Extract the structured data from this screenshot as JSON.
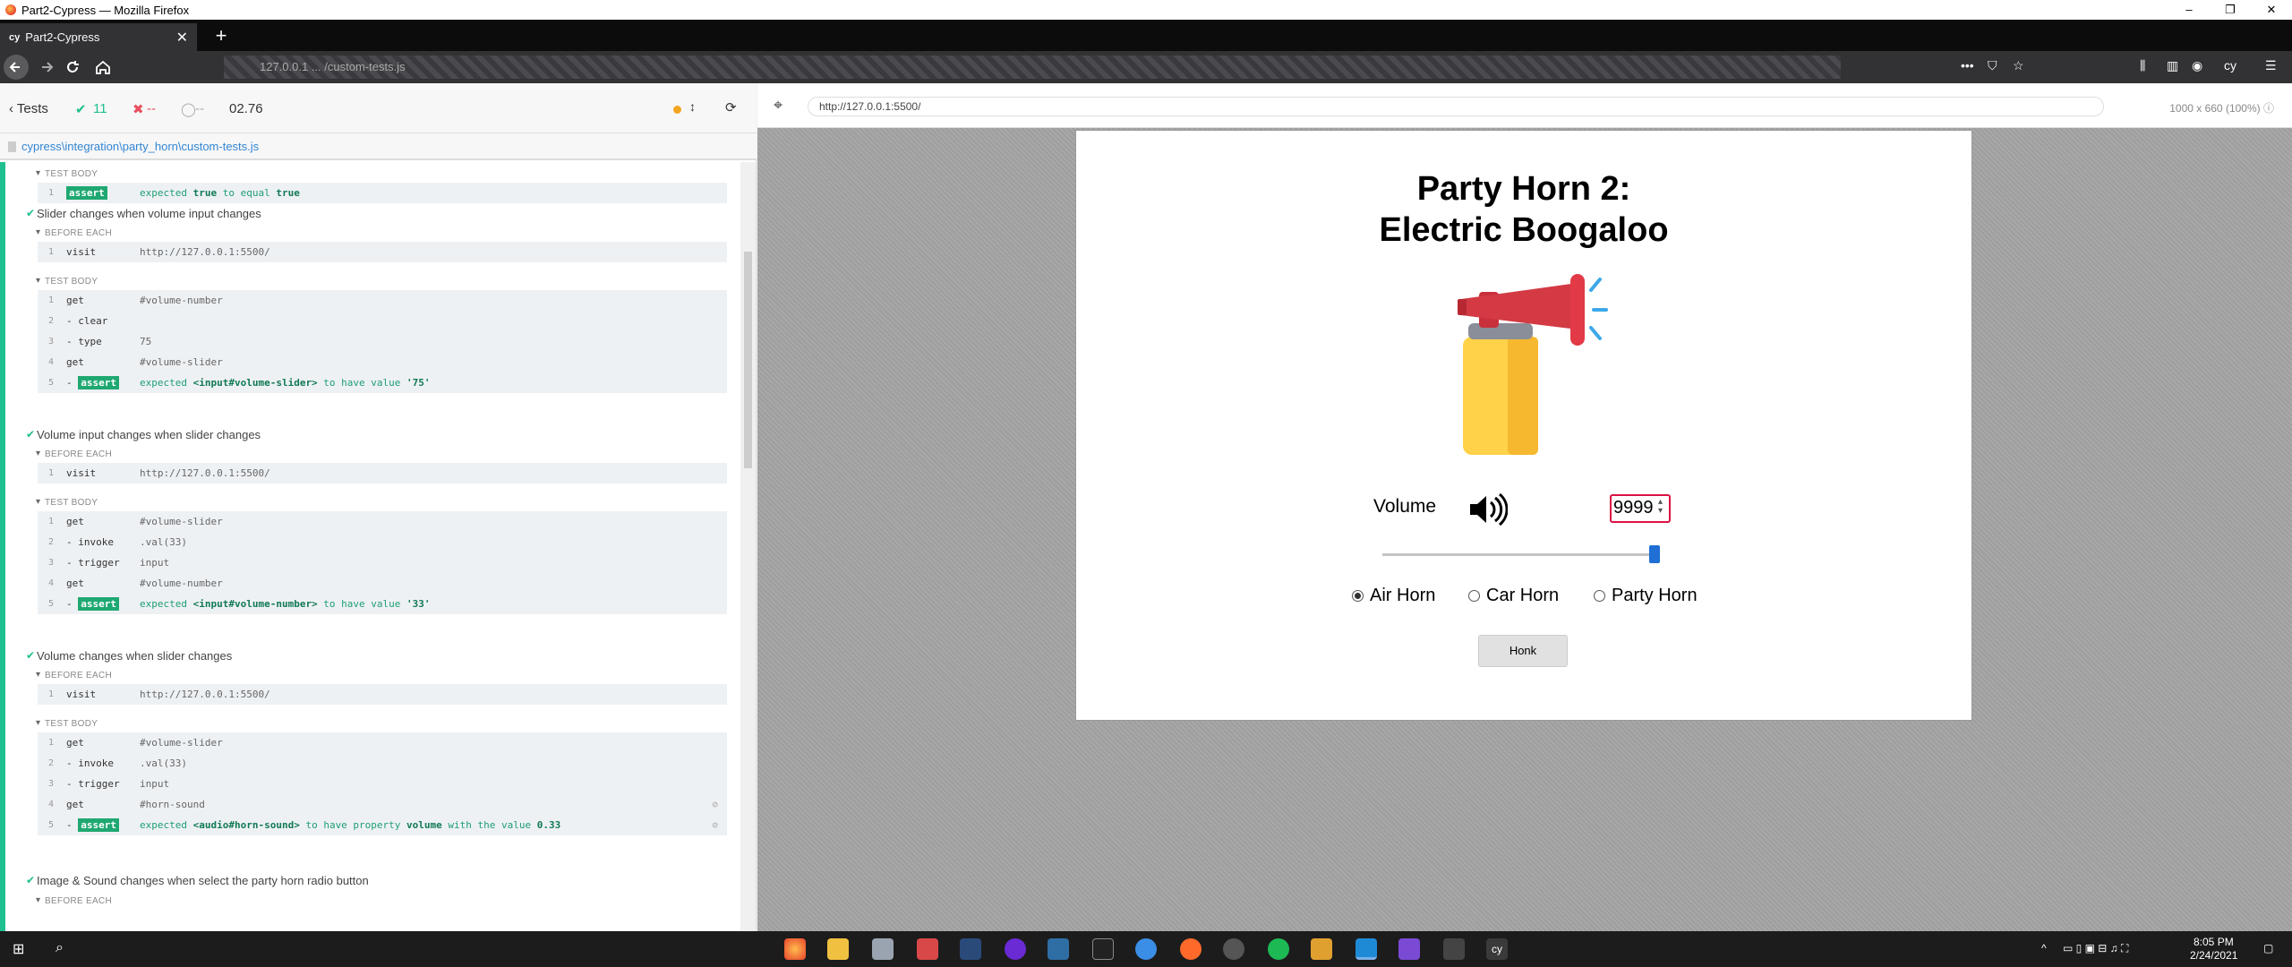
{
  "window": {
    "title": "Part2-Cypress — Mozilla Firefox",
    "controls": [
      "–",
      "❐",
      "✕"
    ]
  },
  "tab": {
    "label": "Part2-Cypress",
    "favicon": "cy",
    "close": "✕",
    "new_tab": "+"
  },
  "nav": {
    "url_masked": "127.0.0.1 ... /custom-tests.js"
  },
  "reporter": {
    "tests_label": "Tests",
    "passed": "11",
    "failed": "--",
    "pending": "--",
    "duration": "02.76",
    "spec_path": "cypress\\integration\\party_horn\\custom-tests.js",
    "sections": {
      "before_each": "BEFORE EACH",
      "test_body": "TEST BODY"
    },
    "tests": [
      {
        "title": "Slider changes when volume input changes"
      },
      {
        "title": "Volume input changes when slider changes"
      },
      {
        "title": "Volume changes when slider changes"
      },
      {
        "title": "Image & Sound changes when select the party horn radio button"
      }
    ],
    "cmds": {
      "top_assert": {
        "n": "1",
        "name": "assert",
        "msg_pre": "expected ",
        "v1": "true",
        "msg_mid": " to equal ",
        "v2": "true"
      },
      "t1_visit": {
        "n": "1",
        "name": "visit",
        "msg": "http://127.0.0.1:5500/"
      },
      "t1_body": [
        {
          "n": "1",
          "name": "get",
          "msg": "#volume-number"
        },
        {
          "n": "2",
          "name": "- clear",
          "msg": ""
        },
        {
          "n": "3",
          "name": "- type",
          "msg": "75"
        },
        {
          "n": "4",
          "name": "get",
          "msg": "#volume-slider"
        }
      ],
      "t1_assert": {
        "n": "5",
        "name": "assert",
        "msg_pre": "expected ",
        "v1": "<input#volume-slider>",
        "msg_mid": " to have value ",
        "v2": "'75'"
      },
      "t2_visit": {
        "n": "1",
        "name": "visit",
        "msg": "http://127.0.0.1:5500/"
      },
      "t2_body": [
        {
          "n": "1",
          "name": "get",
          "msg": "#volume-slider"
        },
        {
          "n": "2",
          "name": "- invoke",
          "msg": ".val(33)"
        },
        {
          "n": "3",
          "name": "- trigger",
          "msg": "input"
        },
        {
          "n": "4",
          "name": "get",
          "msg": "#volume-number"
        }
      ],
      "t2_assert": {
        "n": "5",
        "name": "assert",
        "msg_pre": "expected ",
        "v1": "<input#volume-number>",
        "msg_mid": " to have value ",
        "v2": "'33'"
      },
      "t3_visit": {
        "n": "1",
        "name": "visit",
        "msg": "http://127.0.0.1:5500/"
      },
      "t3_body": [
        {
          "n": "1",
          "name": "get",
          "msg": "#volume-slider"
        },
        {
          "n": "2",
          "name": "- invoke",
          "msg": ".val(33)"
        },
        {
          "n": "3",
          "name": "- trigger",
          "msg": "input"
        },
        {
          "n": "4",
          "name": "get",
          "msg": "#horn-sound"
        }
      ],
      "t3_assert": {
        "n": "5",
        "name": "assert",
        "msg_pre": "expected ",
        "v1": "<audio#horn-sound>",
        "msg_mid": " to have property ",
        "v2": "volume",
        "msg_end": " with the value ",
        "v3": "0.33"
      }
    },
    "bottom_section": "BEFORE EACH"
  },
  "runner": {
    "url": "http://127.0.0.1:5500/",
    "viewport": "1000 x 660",
    "scale": "(100%)"
  },
  "app": {
    "title_line1": "Party Horn 2:",
    "title_line2": "Electric Boogaloo",
    "volume_label": "Volume",
    "volume_value": "9999",
    "slider_value": 100,
    "radios": [
      {
        "label": "Air Horn",
        "checked": true
      },
      {
        "label": "Car Horn",
        "checked": false
      },
      {
        "label": "Party Horn",
        "checked": false
      }
    ],
    "honk_label": "Honk"
  },
  "taskbar": {
    "time": "8:05 PM",
    "date": "2/24/2021"
  }
}
